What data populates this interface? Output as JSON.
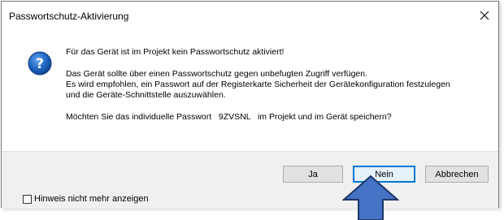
{
  "dialog": {
    "title": "Passwortschutz-Aktivierung",
    "close_icon": "close-icon",
    "icon": "question-icon"
  },
  "message": {
    "line1": "Für das Gerät ist im Projekt kein Passwortschutz aktiviert!",
    "line2": "Das Gerät sollte über einen Passwortschutz gegen unbefugten Zugriff verfügen.",
    "line3": "Es wird empfohlen, ein Passwort auf der Registerkarte Sicherheit der Gerätekonfiguration festzulegen",
    "line4": "und die Geräte-Schnittstelle auszuwählen.",
    "question": "Möchten Sie das individuelle Passwort   9ZVSNL   im Projekt und im Gerät speichern?"
  },
  "buttons": {
    "ja": "Ja",
    "nein": "Nein",
    "abbrechen": "Abbrechen"
  },
  "checkbox": {
    "label": "Hinweis nicht mehr anzeigen",
    "checked": false
  },
  "annotation": {
    "arrow_icon": "up-arrow-icon",
    "arrow_color": "#4472c4",
    "arrow_border": "#1f3864"
  },
  "colors": {
    "icon_blue": "#1c5fb8",
    "default_button_border": "#0078d7"
  }
}
